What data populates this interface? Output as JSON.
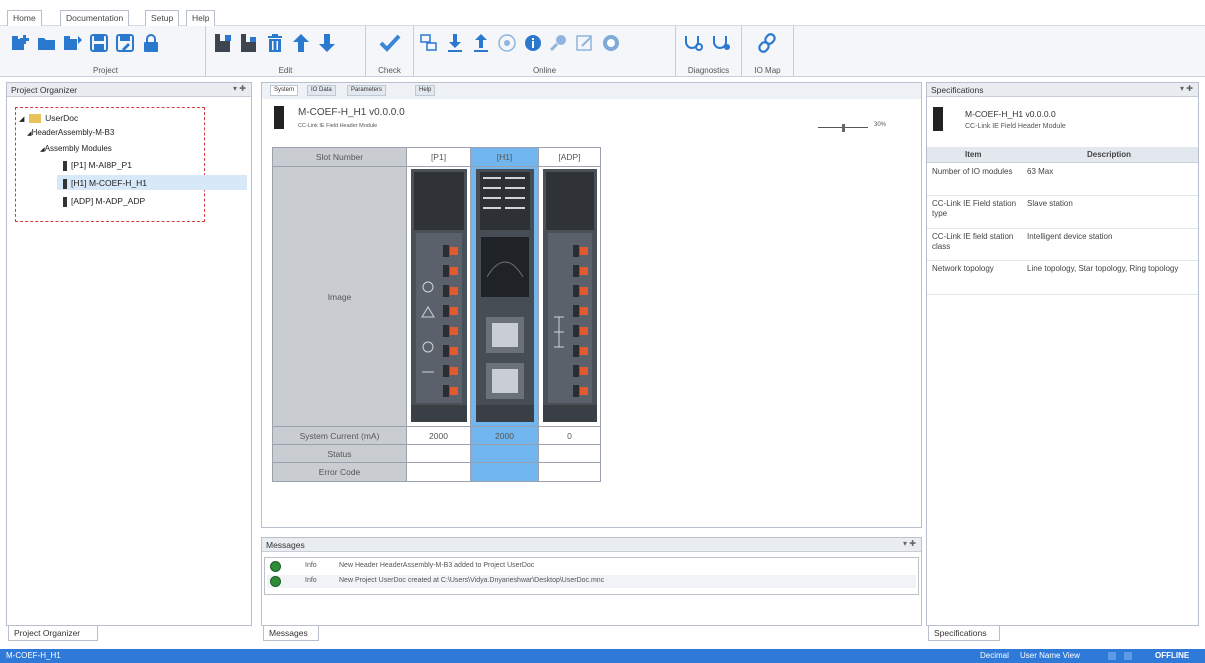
{
  "menu": {
    "tabs": [
      "Home",
      "Documentation",
      "Setup",
      "Help"
    ]
  },
  "ribbon": {
    "groups": [
      {
        "label": "Project"
      },
      {
        "label": "Edit"
      },
      {
        "label": "Check"
      },
      {
        "label": "Online"
      },
      {
        "label": "Diagnostics"
      },
      {
        "label": "IO Map"
      }
    ],
    "colors": {
      "icon": "#2b79cf",
      "check": "#3a86d6"
    }
  },
  "project_organizer": {
    "title": "Project Organizer",
    "tree": {
      "root": "UserDoc",
      "header": "HeaderAssembly-M-B3",
      "assembly": "Assembly Modules",
      "items": [
        "[P1] M-AI8P_P1",
        "[H1] M-COEF-H_H1",
        "[ADP] M-ADP_ADP"
      ]
    },
    "bottom_tab": "Project Organizer"
  },
  "document": {
    "tabs": [
      "System",
      "IO Data",
      "Parameters",
      "Help"
    ],
    "module_name": "M-COEF-H_H1 v0.0.0.0",
    "module_desc": "CC-Link IE Field Header Module",
    "zoom": "30%",
    "zoom_level": 0.5,
    "table": {
      "row_labels": {
        "slot": "Slot Number",
        "image": "Image",
        "current": "System Current (mA)",
        "status": "Status",
        "error": "Error Code"
      },
      "slots": [
        "[P1]",
        "[H1]",
        "[ADP]"
      ],
      "currents": [
        "2000",
        "2000",
        "0"
      ],
      "selected_index": 1
    }
  },
  "messages": {
    "title": "Messages",
    "items": [
      {
        "level": "Info",
        "text": "New Header HeaderAssembly-M-B3 added to Project UserDoc"
      },
      {
        "level": "Info",
        "text": "New Project UserDoc created at C:\\Users\\Vidya.Dnyaneshwar\\Desktop\\UserDoc.mnc"
      }
    ],
    "bottom_tab": "Messages"
  },
  "specifications": {
    "title": "Specifications",
    "module_name": "M-COEF-H_H1 v0.0.0.0",
    "module_desc": "CC-Link IE Field Header Module",
    "col_item": "Item",
    "col_desc": "Description",
    "rows": [
      {
        "item": "Number of IO modules",
        "desc": "63 Max"
      },
      {
        "item": "CC-Link IE Field station type",
        "desc": "Slave station"
      },
      {
        "item": "CC-Link IE field station class",
        "desc": "Intelligent device station"
      },
      {
        "item": "Network topology",
        "desc": "Line topology, Star topology, Ring topology"
      }
    ],
    "bottom_tab": "Specifications"
  },
  "status_bar": {
    "left": "M-COEF-H_H1",
    "number_format": "Decimal",
    "view": "User Name View",
    "mode": "OFFLINE"
  }
}
